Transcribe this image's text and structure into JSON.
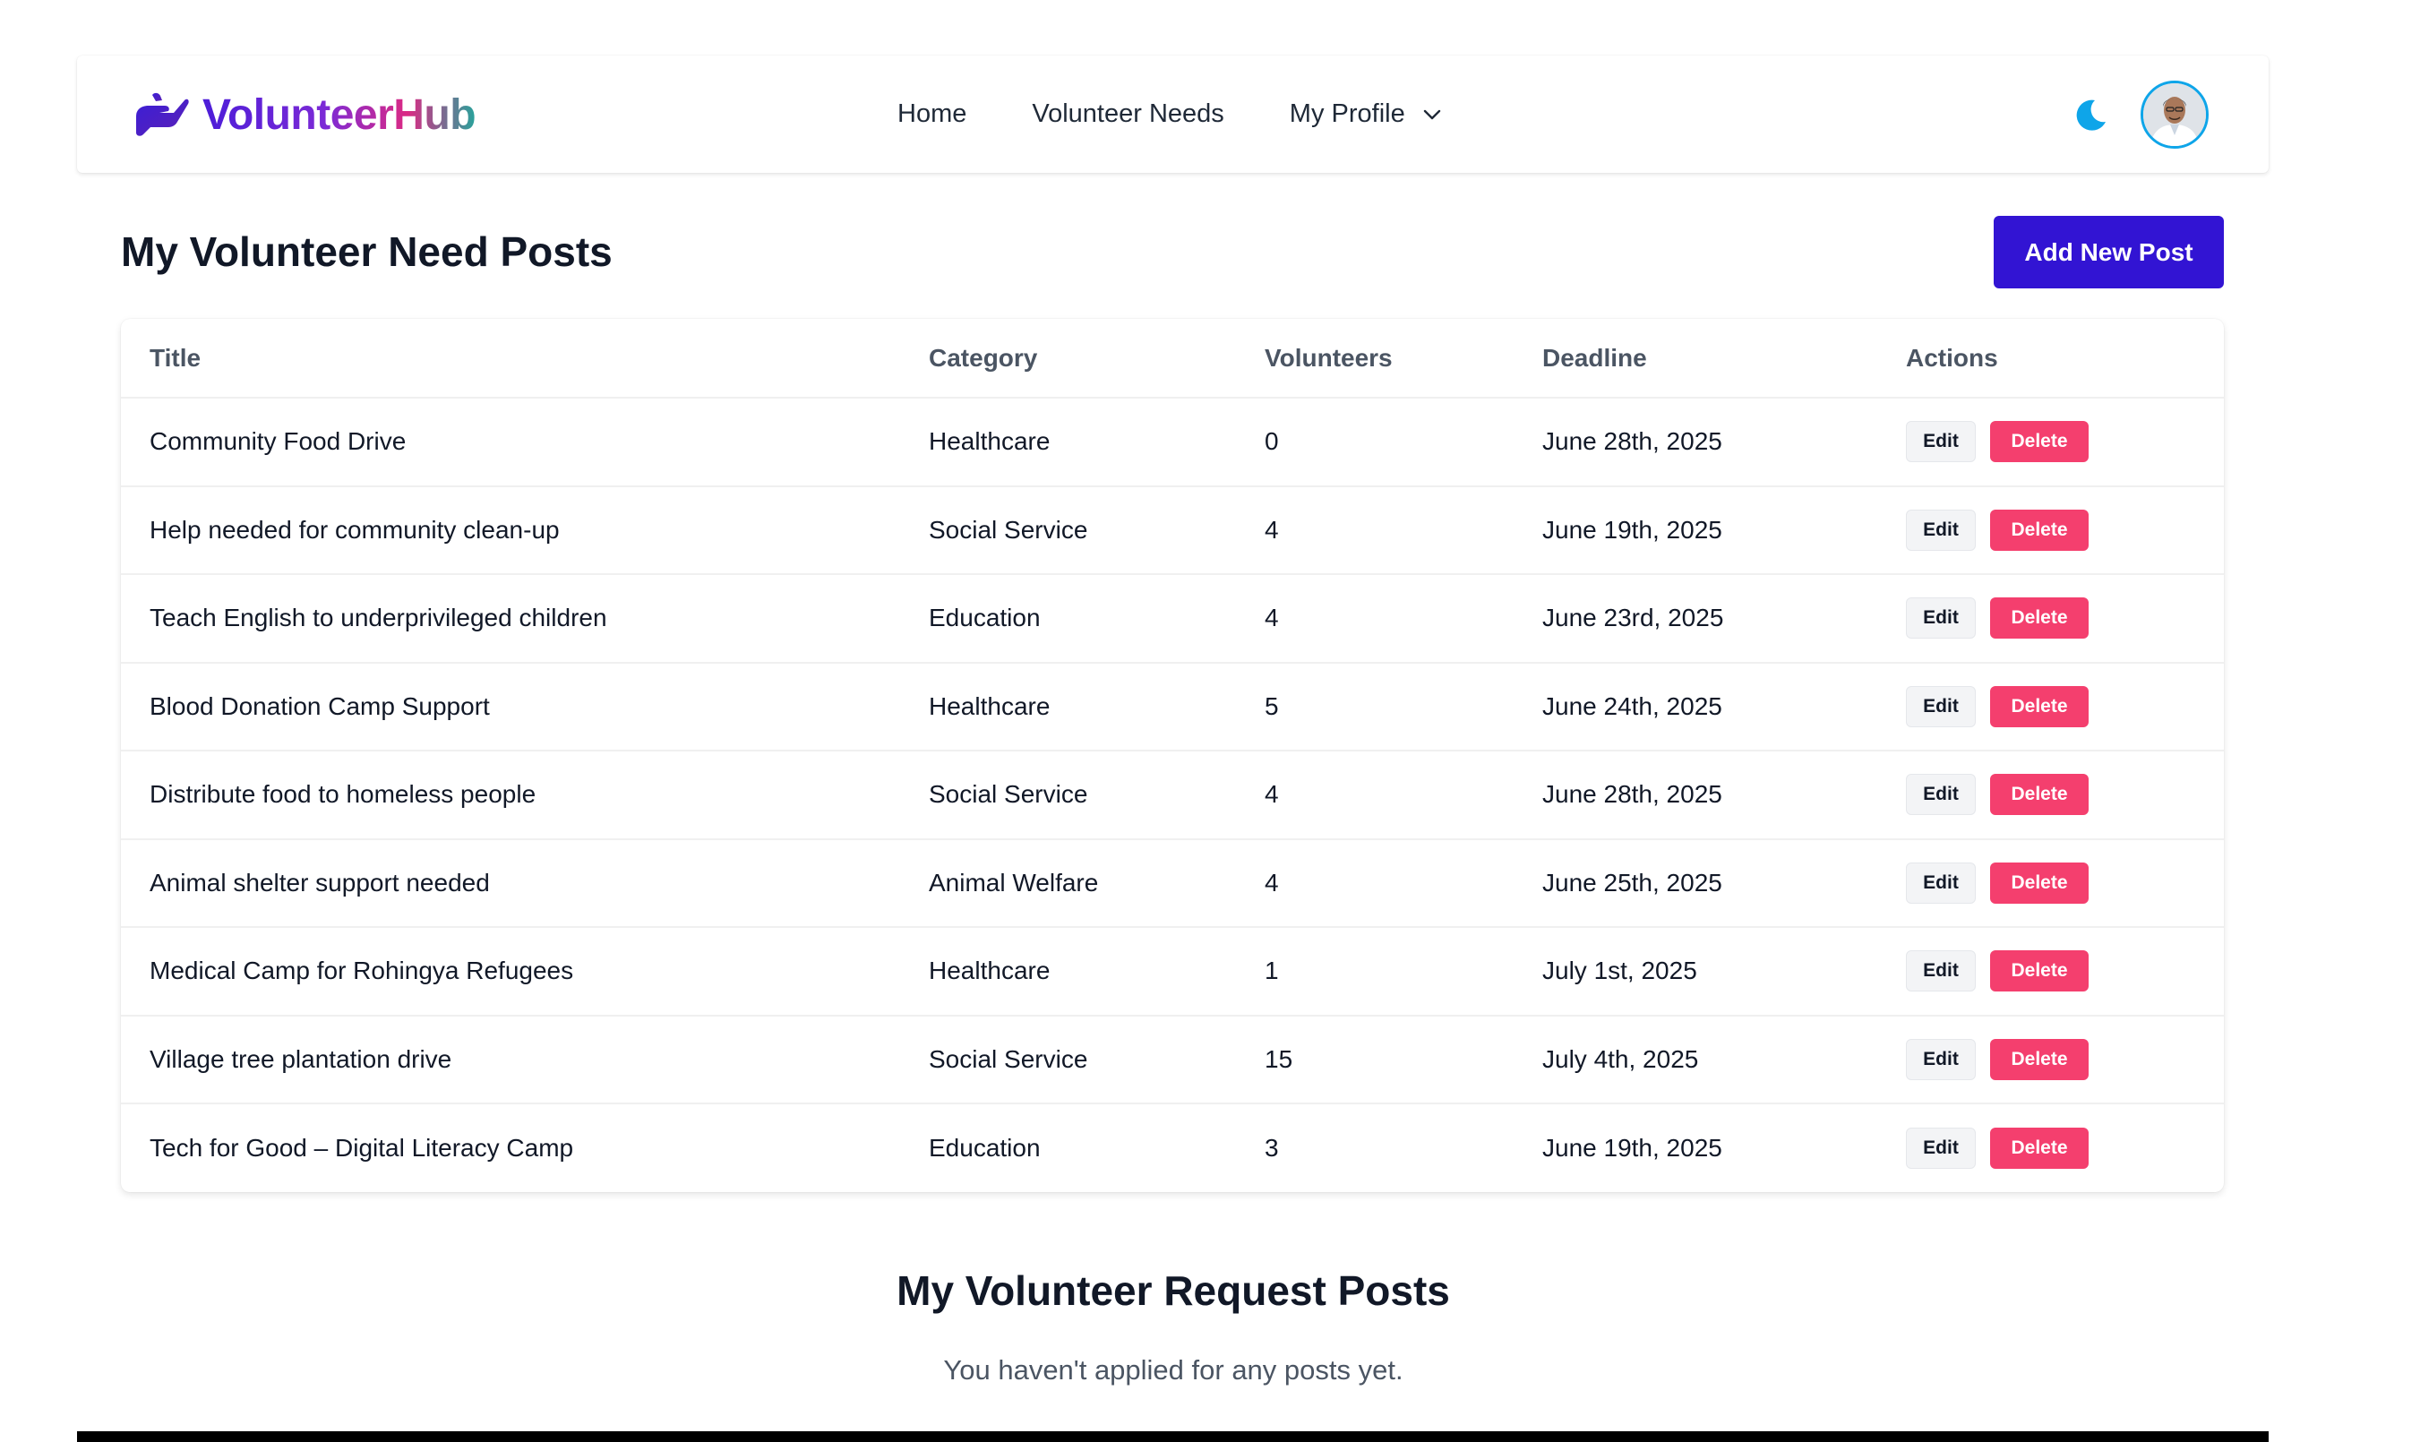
{
  "brand": {
    "name": "VolunteerHub",
    "gradient": [
      "#4c1dd8",
      "#7c2ad6",
      "#db2a84",
      "#28a39b"
    ],
    "logo_icon": "helping-hand-icon"
  },
  "nav": {
    "links": [
      "Home",
      "Volunteer Needs",
      "My Profile"
    ],
    "profile_icon": "chevron-down-icon",
    "theme_icon": "moon-icon",
    "theme_color": "#0ea5e9"
  },
  "page": {
    "title": "My Volunteer Need Posts",
    "add_button": "Add New Post",
    "accent": "#3214d3"
  },
  "table": {
    "headers": [
      "Title",
      "Category",
      "Volunteers",
      "Deadline",
      "Actions"
    ],
    "edit_label": "Edit",
    "delete_label": "Delete",
    "delete_color": "#f43f6e",
    "rows": [
      {
        "title": "Community Food Drive",
        "category": "Healthcare",
        "volunteers": "0",
        "deadline": "June 28th, 2025"
      },
      {
        "title": "Help needed for community clean-up",
        "category": "Social Service",
        "volunteers": "4",
        "deadline": "June 19th, 2025"
      },
      {
        "title": "Teach English to underprivileged children",
        "category": "Education",
        "volunteers": "4",
        "deadline": "June 23rd, 2025"
      },
      {
        "title": "Blood Donation Camp Support",
        "category": "Healthcare",
        "volunteers": "5",
        "deadline": "June 24th, 2025"
      },
      {
        "title": "Distribute food to homeless people",
        "category": "Social Service",
        "volunteers": "4",
        "deadline": "June 28th, 2025"
      },
      {
        "title": "Animal shelter support needed",
        "category": "Animal Welfare",
        "volunteers": "4",
        "deadline": "June 25th, 2025"
      },
      {
        "title": "Medical Camp for Rohingya Refugees",
        "category": "Healthcare",
        "volunteers": "1",
        "deadline": "July 1st, 2025"
      },
      {
        "title": "Village tree plantation drive",
        "category": "Social Service",
        "volunteers": "15",
        "deadline": "July 4th, 2025"
      },
      {
        "title": "Tech for Good – Digital Literacy Camp",
        "category": "Education",
        "volunteers": "3",
        "deadline": "June 19th, 2025"
      }
    ]
  },
  "requests": {
    "title": "My Volunteer Request Posts",
    "empty_message": "You haven't applied for any posts yet."
  }
}
